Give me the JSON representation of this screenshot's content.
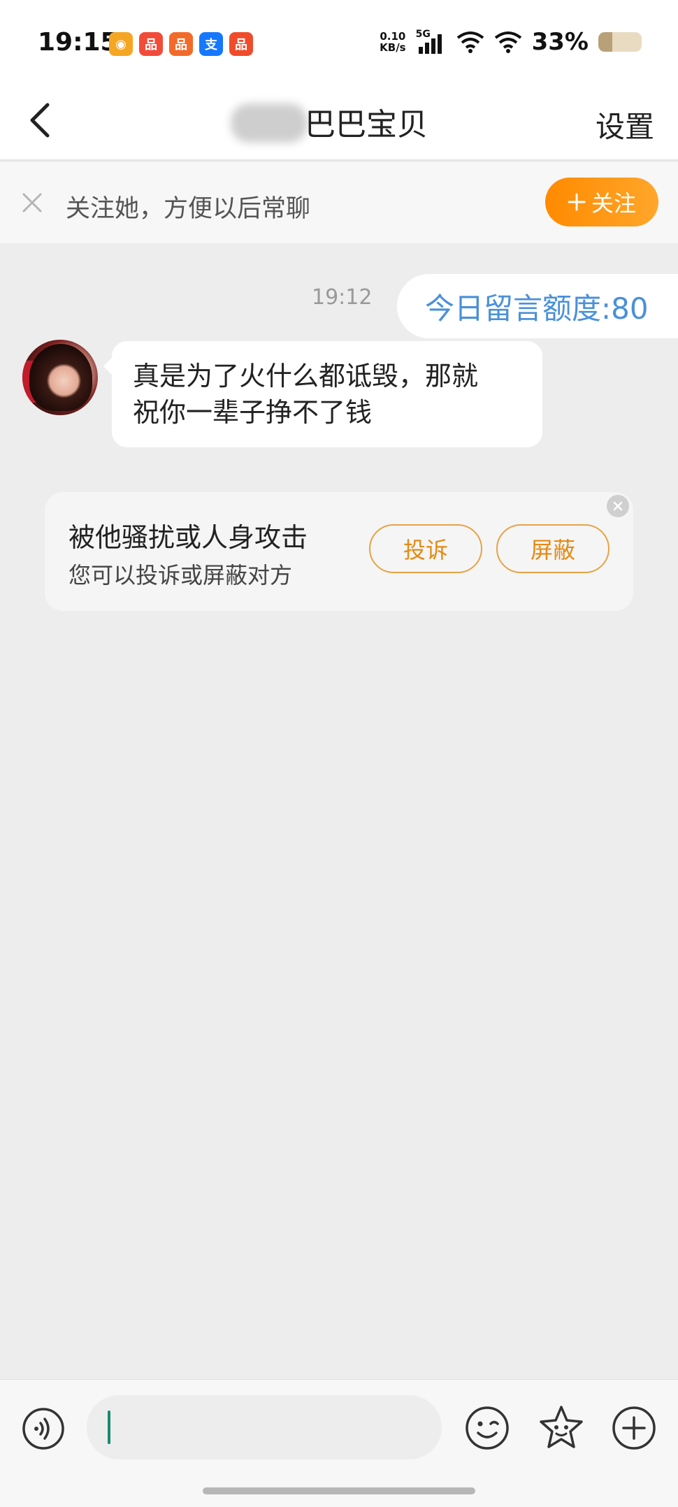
{
  "status_bar": {
    "time": "19:15",
    "net_speed_value": "0.10",
    "net_speed_unit": "KB/s",
    "network": "5G",
    "battery_percent": "33%",
    "battery_level": 0.33,
    "app_icons": [
      {
        "name": "weibo-icon",
        "color": "#f5a623"
      },
      {
        "name": "app-icon",
        "color": "#f24b3a"
      },
      {
        "name": "app-icon",
        "color": "#f26a2a"
      },
      {
        "name": "alipay-icon",
        "color": "#1677ff"
      },
      {
        "name": "app-icon",
        "color": "#f04c2b"
      }
    ]
  },
  "navbar": {
    "title": "巴巴宝贝",
    "settings_label": "设置"
  },
  "follow_banner": {
    "text": "关注她，方便以后常聊",
    "button_label": "关注",
    "accent_color": "#ff8a00"
  },
  "chat": {
    "messages": [
      {
        "type": "timestamp",
        "text": "19:12"
      },
      {
        "type": "system",
        "text": "今日留言额度:80"
      },
      {
        "type": "incoming",
        "lines": [
          "真是为了火什么都诋毁，那就",
          "祝你一辈子挣不了钱"
        ]
      }
    ],
    "report_card": {
      "title": "被他骚扰或人身攻击",
      "subtitle": "您可以投诉或屏蔽对方",
      "complain_label": "投诉",
      "block_label": "屏蔽"
    }
  },
  "input_bar": {
    "value": "",
    "placeholder": ""
  }
}
